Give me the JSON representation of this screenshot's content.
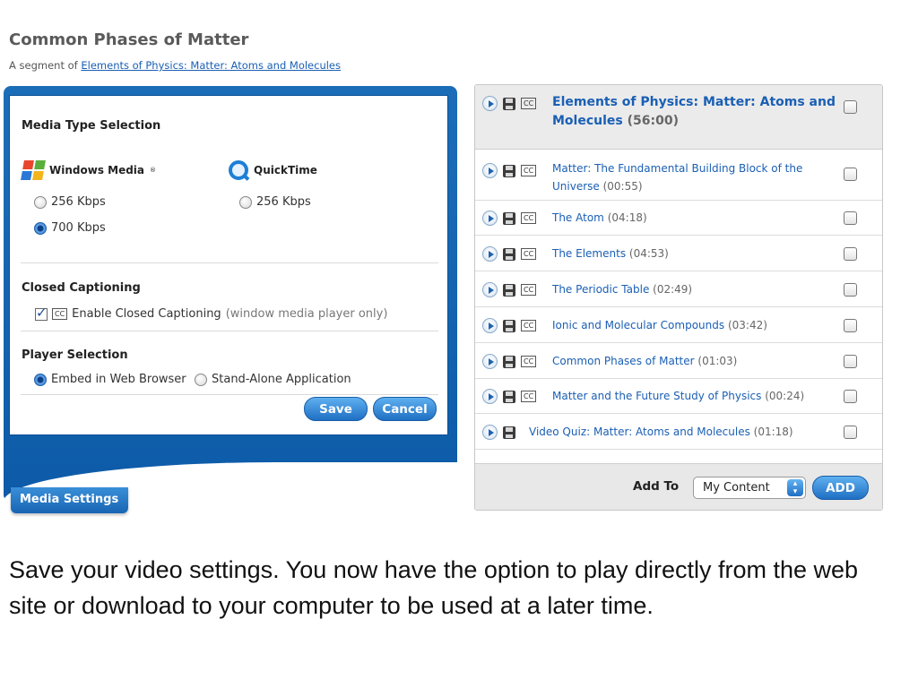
{
  "header": {
    "title": "Common Phases of Matter",
    "segment_prefix": "A segment of",
    "segment_link": "Elements of Physics: Matter: Atoms and Molecules"
  },
  "settings": {
    "media_type_heading": "Media Type Selection",
    "windows_media_label": "Windows Media",
    "quicktime_label": "QuickTime",
    "windows_options": [
      {
        "label": "256 Kbps",
        "selected": false
      },
      {
        "label": "700 Kbps",
        "selected": true
      }
    ],
    "quicktime_options": [
      {
        "label": "256 Kbps",
        "selected": false
      }
    ],
    "closed_captioning_heading": "Closed Captioning",
    "cc_enable_label": "Enable Closed Captioning",
    "cc_enable_hint": "(window media player only)",
    "cc_enabled": true,
    "player_heading": "Player Selection",
    "player_options": [
      {
        "label": "Embed in Web Browser",
        "selected": true
      },
      {
        "label": "Stand-Alone Application",
        "selected": false
      }
    ],
    "save_label": "Save",
    "cancel_label": "Cancel",
    "tab_label": "Media Settings"
  },
  "playlist": {
    "header": {
      "title": "Elements of Physics: Matter: Atoms and Molecules",
      "duration": "(56:00)"
    },
    "items": [
      {
        "title": "Matter: The Fundamental Building Block of the Universe",
        "duration": "(00:55)",
        "has_cc": true
      },
      {
        "title": "The Atom",
        "duration": "(04:18)",
        "has_cc": true
      },
      {
        "title": "The Elements",
        "duration": "(04:53)",
        "has_cc": true
      },
      {
        "title": "The Periodic Table",
        "duration": "(02:49)",
        "has_cc": true
      },
      {
        "title": "Ionic and Molecular Compounds",
        "duration": "(03:42)",
        "has_cc": true
      },
      {
        "title": "Common Phases of Matter",
        "duration": "(01:03)",
        "has_cc": true
      },
      {
        "title": "Matter and the Future Study of Physics",
        "duration": "(00:24)",
        "has_cc": true
      },
      {
        "title": "Video Quiz: Matter: Atoms and Molecules",
        "duration": "(01:18)",
        "has_cc": false
      }
    ],
    "add_to_label": "Add To",
    "destination_selected": "My Content",
    "add_button_label": "ADD"
  },
  "caption": "Save your video settings. You now have the option to play directly from the web site or download to your computer to be used at a later time.",
  "colors": {
    "accent": "#1a5fb4",
    "panel_blue": "#1765b3"
  },
  "icons": [
    "windows-media-logo",
    "quicktime-logo",
    "play-icon",
    "save-icon",
    "cc-icon",
    "checkbox",
    "radio-button",
    "select-arrow-icon"
  ]
}
